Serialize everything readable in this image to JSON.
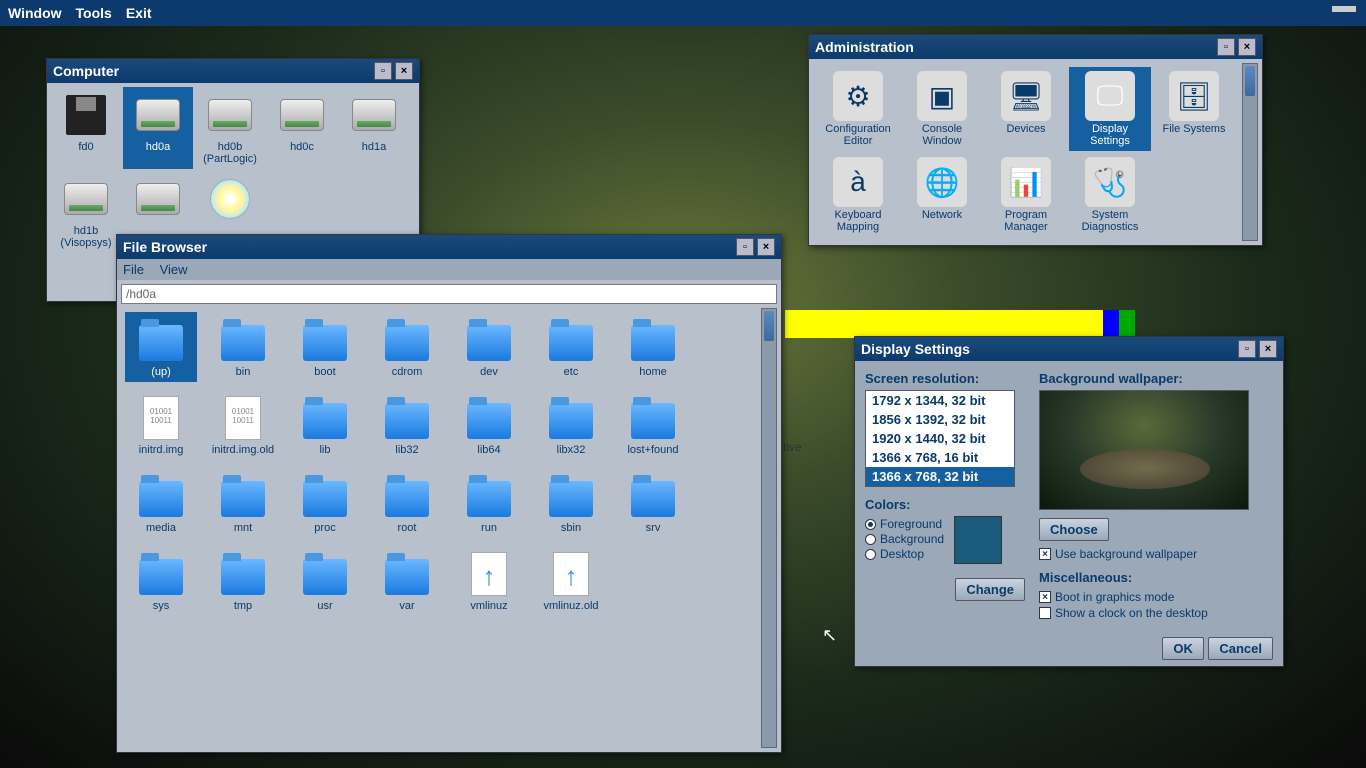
{
  "menubar": {
    "window": "Window",
    "tools": "Tools",
    "exit": "Exit"
  },
  "computer": {
    "title": "Computer",
    "items": [
      {
        "label": "fd0",
        "type": "floppy"
      },
      {
        "label": "hd0a",
        "type": "hdd",
        "selected": true
      },
      {
        "label": "hd0b (PartLogic)",
        "type": "hdd"
      },
      {
        "label": "hd0c",
        "type": "hdd"
      },
      {
        "label": "hd1a",
        "type": "hdd"
      },
      {
        "label": "hd1b (Visopsys)",
        "type": "hdd"
      },
      {
        "label": "",
        "type": "hdd"
      },
      {
        "label": "",
        "type": "cd"
      }
    ]
  },
  "filebrowser": {
    "title": "File Browser",
    "menu_file": "File",
    "menu_view": "View",
    "path": "/hd0a",
    "items": [
      {
        "label": "(up)",
        "type": "folder",
        "selected": true
      },
      {
        "label": "bin",
        "type": "folder"
      },
      {
        "label": "boot",
        "type": "folder"
      },
      {
        "label": "cdrom",
        "type": "folder"
      },
      {
        "label": "dev",
        "type": "folder"
      },
      {
        "label": "etc",
        "type": "folder"
      },
      {
        "label": "home",
        "type": "folder"
      },
      {
        "label": "initrd.img",
        "type": "file-text"
      },
      {
        "label": "initrd.img.old",
        "type": "file-text"
      },
      {
        "label": "lib",
        "type": "folder"
      },
      {
        "label": "lib32",
        "type": "folder"
      },
      {
        "label": "lib64",
        "type": "folder"
      },
      {
        "label": "libx32",
        "type": "folder"
      },
      {
        "label": "lost+found",
        "type": "folder"
      },
      {
        "label": "media",
        "type": "folder"
      },
      {
        "label": "mnt",
        "type": "folder"
      },
      {
        "label": "proc",
        "type": "folder"
      },
      {
        "label": "root",
        "type": "folder"
      },
      {
        "label": "run",
        "type": "folder"
      },
      {
        "label": "sbin",
        "type": "folder"
      },
      {
        "label": "srv",
        "type": "folder"
      },
      {
        "label": "sys",
        "type": "folder"
      },
      {
        "label": "tmp",
        "type": "folder"
      },
      {
        "label": "usr",
        "type": "folder"
      },
      {
        "label": "var",
        "type": "folder"
      },
      {
        "label": "vmlinuz",
        "type": "file-arrow"
      },
      {
        "label": "vmlinuz.old",
        "type": "file-arrow"
      }
    ]
  },
  "admin": {
    "title": "Administration",
    "items": [
      {
        "label": "Configuration Editor",
        "glyph": "⚙"
      },
      {
        "label": "Console Window",
        "glyph": "▣"
      },
      {
        "label": "Devices",
        "glyph": "🖥"
      },
      {
        "label": "Display Settings",
        "glyph": "🖵",
        "selected": true
      },
      {
        "label": "File Systems",
        "glyph": "🗄"
      },
      {
        "label": "Keyboard Mapping",
        "glyph": "à"
      },
      {
        "label": "Network",
        "glyph": "🌐"
      },
      {
        "label": "Program Manager",
        "glyph": "📊"
      },
      {
        "label": "System Diagnostics",
        "glyph": "🩺"
      }
    ]
  },
  "display": {
    "title": "Display Settings",
    "screen_res_label": "Screen resolution:",
    "resolutions": [
      {
        "text": "1792 x 1344, 32 bit"
      },
      {
        "text": "1856 x 1392, 32 bit"
      },
      {
        "text": "1920 x 1440, 32 bit"
      },
      {
        "text": "1366 x 768, 16 bit"
      },
      {
        "text": "1366 x 768, 32 bit",
        "selected": true
      }
    ],
    "colors_label": "Colors:",
    "color_fg": "Foreground",
    "color_bg": "Background",
    "color_desktop": "Desktop",
    "change": "Change",
    "wallpaper_label": "Background wallpaper:",
    "choose": "Choose",
    "use_wallpaper": "Use background wallpaper",
    "misc_label": "Miscellaneous:",
    "boot_graphics": "Boot in graphics mode",
    "show_clock": "Show a clock on the desktop",
    "ok": "OK",
    "cancel": "Cancel"
  },
  "bg_text": "tive"
}
